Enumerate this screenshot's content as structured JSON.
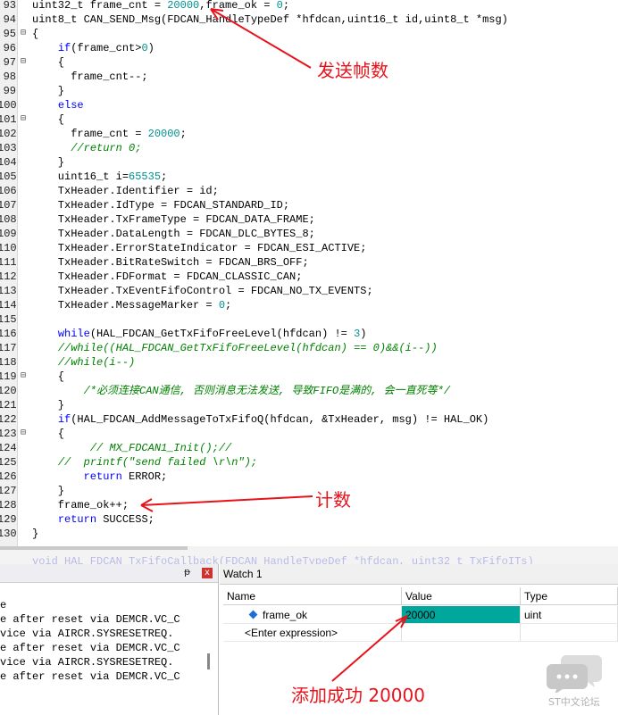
{
  "editor": {
    "lines": [
      {
        "ln": "93",
        "segs": [
          [
            "t",
            "uint32_t frame_cnt = "
          ],
          [
            "n",
            "20000"
          ],
          [
            "t",
            ",frame_ok = "
          ],
          [
            "n",
            "0"
          ],
          [
            "t",
            ";"
          ]
        ]
      },
      {
        "ln": "94",
        "segs": [
          [
            "t",
            "uint8_t CAN_SEND_Msg(FDCAN_HandleTypeDef *hfdcan,uint16_t id,uint8_t *msg)"
          ]
        ]
      },
      {
        "ln": "95",
        "fold": "⊟",
        "segs": [
          [
            "t",
            "{"
          ]
        ]
      },
      {
        "ln": "96",
        "segs": [
          [
            "t",
            "    "
          ],
          [
            "k",
            "if"
          ],
          [
            "t",
            "(frame_cnt>"
          ],
          [
            "n",
            "0"
          ],
          [
            "t",
            ")"
          ]
        ]
      },
      {
        "ln": "97",
        "fold": "⊟",
        "segs": [
          [
            "t",
            "    {"
          ]
        ]
      },
      {
        "ln": "98",
        "segs": [
          [
            "t",
            "      frame_cnt--;"
          ]
        ]
      },
      {
        "ln": "99",
        "segs": [
          [
            "t",
            "    }"
          ]
        ]
      },
      {
        "ln": "100",
        "segs": [
          [
            "t",
            "    "
          ],
          [
            "k",
            "else"
          ]
        ]
      },
      {
        "ln": "101",
        "fold": "⊟",
        "segs": [
          [
            "t",
            "    {"
          ]
        ]
      },
      {
        "ln": "102",
        "segs": [
          [
            "t",
            "      frame_cnt = "
          ],
          [
            "n",
            "20000"
          ],
          [
            "t",
            ";"
          ]
        ]
      },
      {
        "ln": "103",
        "segs": [
          [
            "t",
            "      "
          ],
          [
            "c",
            "//return 0;"
          ]
        ]
      },
      {
        "ln": "104",
        "segs": [
          [
            "t",
            "    }"
          ]
        ]
      },
      {
        "ln": "105",
        "segs": [
          [
            "t",
            "    uint16_t i="
          ],
          [
            "n",
            "65535"
          ],
          [
            "t",
            ";"
          ]
        ]
      },
      {
        "ln": "106",
        "segs": [
          [
            "t",
            "    TxHeader.Identifier = id;"
          ]
        ]
      },
      {
        "ln": "107",
        "segs": [
          [
            "t",
            "    TxHeader.IdType = FDCAN_STANDARD_ID;"
          ]
        ]
      },
      {
        "ln": "108",
        "segs": [
          [
            "t",
            "    TxHeader.TxFrameType = FDCAN_DATA_FRAME;"
          ]
        ]
      },
      {
        "ln": "109",
        "segs": [
          [
            "t",
            "    TxHeader.DataLength = FDCAN_DLC_BYTES_8;"
          ]
        ]
      },
      {
        "ln": "110",
        "segs": [
          [
            "t",
            "    TxHeader.ErrorStateIndicator = FDCAN_ESI_ACTIVE;"
          ]
        ]
      },
      {
        "ln": "111",
        "segs": [
          [
            "t",
            "    TxHeader.BitRateSwitch = FDCAN_BRS_OFF;"
          ]
        ]
      },
      {
        "ln": "112",
        "segs": [
          [
            "t",
            "    TxHeader.FDFormat = FDCAN_CLASSIC_CAN;"
          ]
        ]
      },
      {
        "ln": "113",
        "segs": [
          [
            "t",
            "    TxHeader.TxEventFifoControl = FDCAN_NO_TX_EVENTS;"
          ]
        ]
      },
      {
        "ln": "114",
        "segs": [
          [
            "t",
            "    TxHeader.MessageMarker = "
          ],
          [
            "n",
            "0"
          ],
          [
            "t",
            ";"
          ]
        ]
      },
      {
        "ln": "115",
        "segs": [
          [
            "t",
            ""
          ]
        ]
      },
      {
        "ln": "116",
        "segs": [
          [
            "t",
            "    "
          ],
          [
            "k",
            "while"
          ],
          [
            "t",
            "(HAL_FDCAN_GetTxFifoFreeLevel(hfdcan) != "
          ],
          [
            "n",
            "3"
          ],
          [
            "t",
            ")"
          ]
        ]
      },
      {
        "ln": "117",
        "segs": [
          [
            "t",
            "    "
          ],
          [
            "c",
            "//while((HAL_FDCAN_GetTxFifoFreeLevel(hfdcan) == 0)&&(i--))"
          ]
        ]
      },
      {
        "ln": "118",
        "segs": [
          [
            "t",
            "    "
          ],
          [
            "c",
            "//while(i--)"
          ]
        ]
      },
      {
        "ln": "119",
        "fold": "⊟",
        "segs": [
          [
            "t",
            "    {"
          ]
        ]
      },
      {
        "ln": "120",
        "segs": [
          [
            "t",
            "        "
          ],
          [
            "c",
            "/*必须连接CAN通信, 否则消息无法发送, 导致FIFO是满的, 会一直死等*/"
          ]
        ]
      },
      {
        "ln": "121",
        "segs": [
          [
            "t",
            "    }"
          ]
        ]
      },
      {
        "ln": "122",
        "segs": [
          [
            "t",
            "    "
          ],
          [
            "k",
            "if"
          ],
          [
            "t",
            "(HAL_FDCAN_AddMessageToTxFifoQ(hfdcan, &TxHeader, msg) != HAL_OK)"
          ]
        ]
      },
      {
        "ln": "123",
        "fold": "⊟",
        "segs": [
          [
            "t",
            "    {"
          ]
        ]
      },
      {
        "ln": "124",
        "segs": [
          [
            "t",
            "         "
          ],
          [
            "c",
            "// MX_FDCAN1_Init();//"
          ]
        ]
      },
      {
        "ln": "125",
        "segs": [
          [
            "t",
            "    "
          ],
          [
            "c",
            "//  printf(\"send failed \\r\\n\");"
          ]
        ]
      },
      {
        "ln": "126",
        "segs": [
          [
            "t",
            "        "
          ],
          [
            "k",
            "return"
          ],
          [
            "t",
            " ERROR;"
          ]
        ]
      },
      {
        "ln": "127",
        "segs": [
          [
            "t",
            "    }"
          ]
        ]
      },
      {
        "ln": "128",
        "segs": [
          [
            "t",
            "    frame_ok++;"
          ]
        ]
      },
      {
        "ln": "129",
        "segs": [
          [
            "t",
            "    "
          ],
          [
            "k",
            "return"
          ],
          [
            "t",
            " SUCCESS;"
          ]
        ]
      },
      {
        "ln": "130",
        "segs": [
          [
            "t",
            "}"
          ]
        ]
      }
    ],
    "ghost_line": "void HAL_FDCAN_TxFifoCallback(FDCAN_HandleTypeDef *hfdcan, uint32_t TxFifoITs)"
  },
  "output": {
    "lines": [
      "e",
      "e after reset via DEMCR.VC_C",
      "vice via AIRCR.SYSRESETREQ.",
      "e after reset via DEMCR.VC_C",
      "vice via AIRCR.SYSRESETREQ.",
      "e after reset via DEMCR.VC_C"
    ],
    "pin_label": "ᵽ",
    "close_label": "x"
  },
  "watch": {
    "title": "Watch 1",
    "col_name": "Name",
    "col_value": "Value",
    "col_type": "Type",
    "rows": [
      {
        "name": "frame_ok",
        "value": "20000",
        "type": "uint",
        "highlight_color": "#00a79d"
      },
      {
        "name": "<Enter expression>",
        "value": "",
        "type": ""
      }
    ]
  },
  "annotations": {
    "send_frames": "发送帧数",
    "count": "计数",
    "added_ok": "添加成功 20000",
    "color": "#e8121a"
  },
  "watermark": {
    "label": "ST中文论坛"
  }
}
